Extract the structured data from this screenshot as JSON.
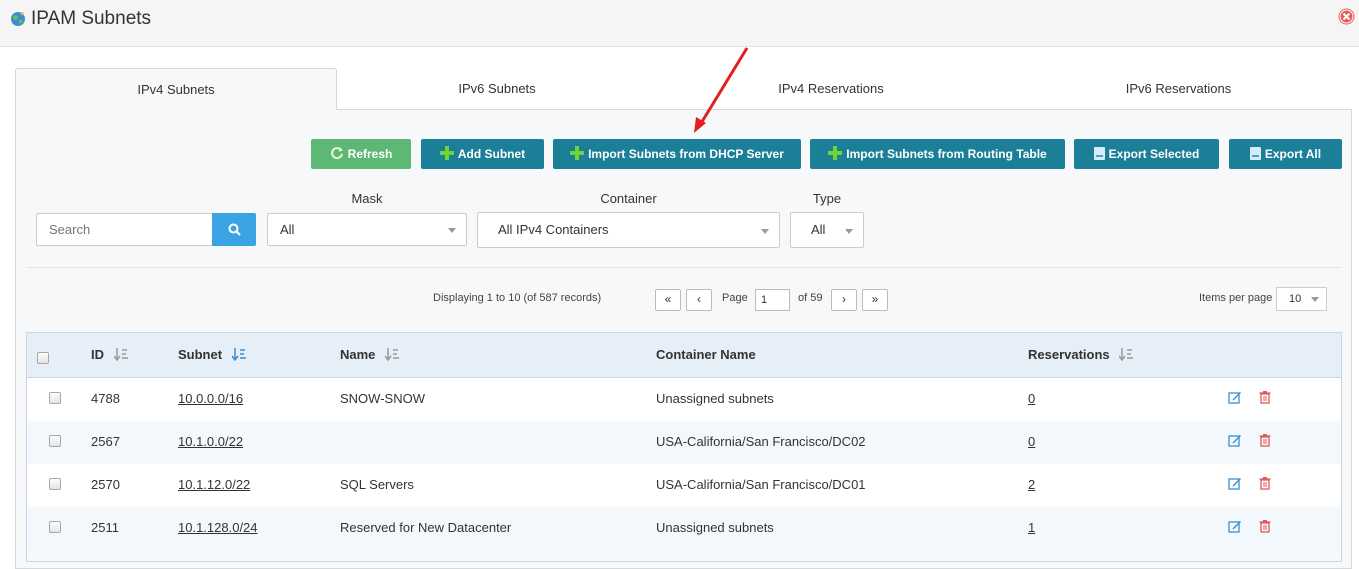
{
  "window": {
    "title": "IPAM Subnets",
    "title_icon": "globe-icon",
    "close_icon": "close-icon"
  },
  "tabs": [
    {
      "label": "IPv4 Subnets",
      "active": true
    },
    {
      "label": "IPv6 Subnets",
      "active": false
    },
    {
      "label": "IPv4 Reservations",
      "active": false
    },
    {
      "label": "IPv6 Reservations",
      "active": false
    }
  ],
  "toolbar": {
    "refresh": "Refresh",
    "add_subnet": "Add Subnet",
    "import_dhcp": "Import Subnets from DHCP Server",
    "import_routing": "Import Subnets from Routing Table",
    "export_selected": "Export Selected",
    "export_all": "Export All"
  },
  "filters": {
    "search_placeholder": "Search",
    "mask_label": "Mask",
    "mask_value": "All",
    "container_label": "Container",
    "container_value": "All IPv4 Containers",
    "type_label": "Type",
    "type_value": "All"
  },
  "pagination": {
    "displaying": "Displaying 1 to 10 (of 587 records)",
    "first": "«",
    "prev": "‹",
    "page_label": "Page",
    "page_value": "1",
    "of_label": "of 59",
    "next": "›",
    "last": "»",
    "items_per_page_label": "Items per page",
    "items_per_page_value": "10"
  },
  "table": {
    "headers": {
      "id": "ID",
      "subnet": "Subnet",
      "name": "Name",
      "container": "Container Name",
      "reservations": "Reservations"
    },
    "rows": [
      {
        "id": "4788",
        "subnet": "10.0.0.0/16",
        "name": "SNOW-SNOW",
        "container": "Unassigned subnets",
        "reservations": "0"
      },
      {
        "id": "2567",
        "subnet": "10.1.0.0/22",
        "name": "",
        "container": "USA-California/San Francisco/DC02",
        "reservations": "0"
      },
      {
        "id": "2570",
        "subnet": "10.1.12.0/22",
        "name": "SQL Servers",
        "container": "USA-California/San Francisco/DC01",
        "reservations": "2"
      },
      {
        "id": "2511",
        "subnet": "10.1.128.0/24",
        "name": "Reserved for New Datacenter",
        "container": "Unassigned subnets",
        "reservations": "1"
      }
    ]
  },
  "colors": {
    "primary_button": "#1a7f97",
    "refresh_button": "#5cb874",
    "search_button": "#3aa3e3",
    "delete_icon": "#e05a5a",
    "edit_icon": "#3a8fd0",
    "annotation_arrow": "#e02020"
  }
}
